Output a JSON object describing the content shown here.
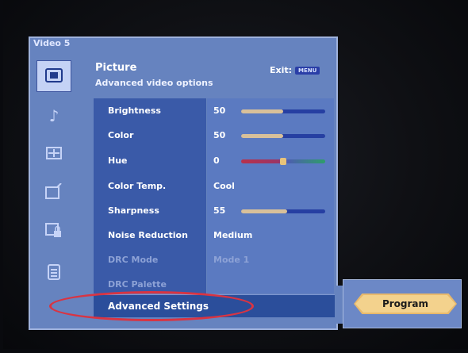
{
  "window": {
    "source_label": "Video 5"
  },
  "header": {
    "title": "Picture",
    "subtitle": "Advanced video options",
    "exit_label": "Exit:",
    "exit_key": "MENU"
  },
  "sidebar": {
    "items": [
      {
        "icon": "picture-icon",
        "active": true
      },
      {
        "icon": "music-note-icon",
        "active": false
      },
      {
        "icon": "screen-grid-icon",
        "active": false
      },
      {
        "icon": "tv-antenna-icon",
        "active": false
      },
      {
        "icon": "parental-lock-icon",
        "active": false
      },
      {
        "icon": "list-icon",
        "active": false
      }
    ]
  },
  "settings": {
    "rows": [
      {
        "label": "Brightness",
        "value": "50",
        "slider": 0.5,
        "enabled": true
      },
      {
        "label": "Color",
        "value": "50",
        "slider": 0.5,
        "enabled": true
      },
      {
        "label": "Hue",
        "value": "0",
        "slider": 0.5,
        "enabled": true,
        "hue": true
      },
      {
        "label": "Color Temp.",
        "value": "Cool",
        "enabled": true
      },
      {
        "label": "Sharpness",
        "value": "55",
        "slider": 0.55,
        "enabled": true
      },
      {
        "label": "Noise Reduction",
        "value": "Medium",
        "enabled": true
      },
      {
        "label": "DRC Mode",
        "value": "Mode 1",
        "enabled": false
      },
      {
        "label": "DRC Palette",
        "value": "",
        "enabled": false
      }
    ],
    "selected": {
      "label": "Advanced Settings"
    }
  },
  "submenu": {
    "button_label": "Program"
  },
  "colors": {
    "panel": "#6683bf",
    "left_column": "#3a5aa8",
    "selected": "#2b4e9b",
    "accent": "#e8b96c",
    "annotation": "#d93442"
  }
}
